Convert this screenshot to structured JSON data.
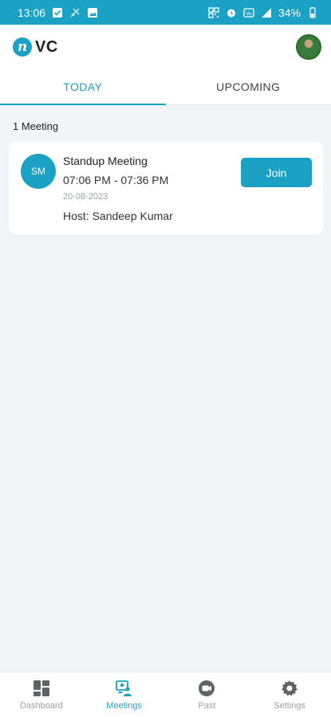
{
  "status_bar": {
    "time": "13:06",
    "battery": "34%"
  },
  "header": {
    "logo_letter": "n",
    "logo_text": "VC"
  },
  "tabs": [
    {
      "label": "TODAY",
      "active": true
    },
    {
      "label": "UPCOMING",
      "active": false
    }
  ],
  "meetings": {
    "count_label": "1 Meeting",
    "items": [
      {
        "initials": "SM",
        "title": "Standup Meeting",
        "time": "07:06 PM - 07:36 PM",
        "date": "20-08-2023",
        "host": "Host:  Sandeep Kumar",
        "join_label": "Join"
      }
    ]
  },
  "bottom_nav": [
    {
      "label": "Dashboard",
      "icon": "dashboard-icon",
      "active": false
    },
    {
      "label": "Meetings",
      "icon": "meetings-icon",
      "active": true
    },
    {
      "label": "Past",
      "icon": "video-icon",
      "active": false
    },
    {
      "label": "Settings",
      "icon": "gear-icon",
      "active": false
    }
  ],
  "colors": {
    "accent": "#1aa1c4",
    "background": "#f2f4f7",
    "muted": "#9aa0a6"
  }
}
